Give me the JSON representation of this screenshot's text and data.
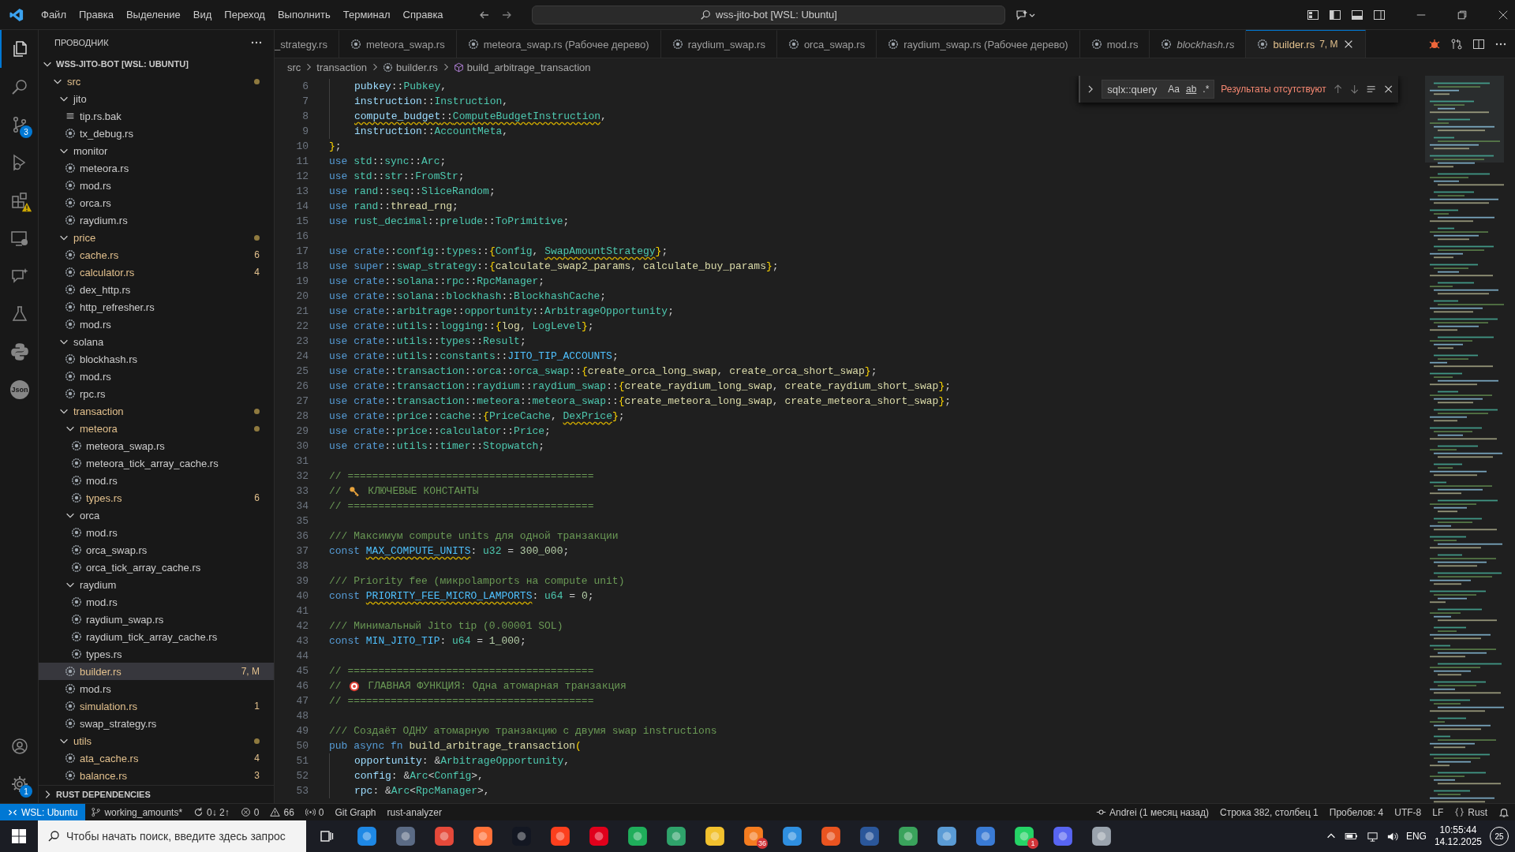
{
  "title_bar": {
    "menu": [
      "Файл",
      "Правка",
      "Выделение",
      "Вид",
      "Переход",
      "Выполнить",
      "Терминал",
      "Справка"
    ],
    "search": "wss-jito-bot [WSL: Ubuntu]"
  },
  "activity_bar": {
    "top": [
      {
        "kind": "files",
        "selected": true
      },
      {
        "kind": "search",
        "selected": false
      },
      {
        "kind": "source-control",
        "selected": false,
        "badge": "3"
      },
      {
        "kind": "run",
        "selected": false
      },
      {
        "kind": "extensions",
        "selected": false,
        "warning": true
      },
      {
        "kind": "remote",
        "selected": false
      },
      {
        "kind": "chat",
        "selected": false
      },
      {
        "kind": "testing",
        "selected": false
      },
      {
        "kind": "python",
        "selected": false
      },
      {
        "kind": "json",
        "selected": false,
        "label": "Json"
      }
    ],
    "bottom": [
      {
        "kind": "account",
        "selected": false
      },
      {
        "kind": "settings",
        "selected": false,
        "badge": "1"
      }
    ]
  },
  "explorer": {
    "title": "ПРОВОДНИК",
    "root": {
      "name": "WSS-JITO-BOT [WSL: UBUNTU]",
      "expanded": true,
      "children": [
        {
          "name": "src",
          "kind": "folder",
          "expanded": true,
          "modified": true,
          "selected": false,
          "children": [
            {
              "name": "jito",
              "kind": "folder",
              "expanded": true,
              "modified": false,
              "selected": false,
              "children": [
                {
                  "name": "tip.rs.bak",
                  "kind": "text-file",
                  "modified": false,
                  "selected": false
                },
                {
                  "name": "tx_debug.rs",
                  "kind": "file",
                  "modified": false,
                  "selected": false
                }
              ]
            },
            {
              "name": "monitor",
              "kind": "folder",
              "expanded": true,
              "modified": false,
              "selected": false,
              "children": [
                {
                  "name": "meteora.rs",
                  "kind": "file",
                  "modified": false,
                  "selected": false
                },
                {
                  "name": "mod.rs",
                  "kind": "file",
                  "modified": false,
                  "selected": false
                },
                {
                  "name": "orca.rs",
                  "kind": "file",
                  "modified": false,
                  "selected": false
                },
                {
                  "name": "raydium.rs",
                  "kind": "file",
                  "modified": false,
                  "selected": false
                }
              ]
            },
            {
              "name": "price",
              "kind": "folder",
              "expanded": true,
              "modified": true,
              "selected": false,
              "children": [
                {
                  "name": "cache.rs",
                  "kind": "file",
                  "modified": true,
                  "selected": false,
                  "badge": "6"
                },
                {
                  "name": "calculator.rs",
                  "kind": "file",
                  "modified": true,
                  "selected": false,
                  "badge": "4"
                },
                {
                  "name": "dex_http.rs",
                  "kind": "file",
                  "modified": false,
                  "selected": false
                },
                {
                  "name": "http_refresher.rs",
                  "kind": "file",
                  "modified": false,
                  "selected": false
                },
                {
                  "name": "mod.rs",
                  "kind": "file",
                  "modified": false,
                  "selected": false
                }
              ]
            },
            {
              "name": "solana",
              "kind": "folder",
              "expanded": true,
              "modified": false,
              "selected": false,
              "children": [
                {
                  "name": "blockhash.rs",
                  "kind": "file",
                  "modified": false,
                  "selected": false
                },
                {
                  "name": "mod.rs",
                  "kind": "file",
                  "modified": false,
                  "selected": false
                },
                {
                  "name": "rpc.rs",
                  "kind": "file",
                  "modified": false,
                  "selected": false
                }
              ]
            },
            {
              "name": "transaction",
              "kind": "folder",
              "expanded": true,
              "modified": true,
              "selected": false,
              "children": [
                {
                  "name": "meteora",
                  "kind": "folder",
                  "expanded": true,
                  "modified": true,
                  "selected": false,
                  "children": [
                    {
                      "name": "meteora_swap.rs",
                      "kind": "file",
                      "modified": false,
                      "selected": false
                    },
                    {
                      "name": "meteora_tick_array_cache.rs",
                      "kind": "file",
                      "modified": false,
                      "selected": false
                    },
                    {
                      "name": "mod.rs",
                      "kind": "file",
                      "modified": false,
                      "selected": false
                    },
                    {
                      "name": "types.rs",
                      "kind": "file",
                      "modified": true,
                      "selected": false,
                      "badge": "6"
                    }
                  ]
                },
                {
                  "name": "orca",
                  "kind": "folder",
                  "expanded": true,
                  "modified": false,
                  "selected": false,
                  "children": [
                    {
                      "name": "mod.rs",
                      "kind": "file",
                      "modified": false,
                      "selected": false
                    },
                    {
                      "name": "orca_swap.rs",
                      "kind": "file",
                      "modified": false,
                      "selected": false
                    },
                    {
                      "name": "orca_tick_array_cache.rs",
                      "kind": "file",
                      "modified": false,
                      "selected": false
                    }
                  ]
                },
                {
                  "name": "raydium",
                  "kind": "folder",
                  "expanded": true,
                  "modified": false,
                  "selected": false,
                  "children": [
                    {
                      "name": "mod.rs",
                      "kind": "file",
                      "modified": false,
                      "selected": false
                    },
                    {
                      "name": "raydium_swap.rs",
                      "kind": "file",
                      "modified": false,
                      "selected": false
                    },
                    {
                      "name": "raydium_tick_array_cache.rs",
                      "kind": "file",
                      "modified": false,
                      "selected": false
                    },
                    {
                      "name": "types.rs",
                      "kind": "file",
                      "modified": false,
                      "selected": false
                    }
                  ]
                },
                {
                  "name": "builder.rs",
                  "kind": "file",
                  "modified": true,
                  "selected": true,
                  "badge": "7, M"
                },
                {
                  "name": "mod.rs",
                  "kind": "file",
                  "modified": false,
                  "selected": false
                },
                {
                  "name": "simulation.rs",
                  "kind": "file",
                  "modified": true,
                  "selected": false,
                  "badge": "1"
                },
                {
                  "name": "swap_strategy.rs",
                  "kind": "file",
                  "modified": false,
                  "selected": false
                }
              ]
            },
            {
              "name": "utils",
              "kind": "folder",
              "expanded": true,
              "modified": true,
              "selected": false,
              "children": [
                {
                  "name": "ata_cache.rs",
                  "kind": "file",
                  "modified": true,
                  "selected": false,
                  "badge": "4"
                },
                {
                  "name": "balance.rs",
                  "kind": "file",
                  "modified": true,
                  "selected": false,
                  "badge": "3"
                }
              ]
            }
          ]
        }
      ]
    },
    "footer": {
      "name": "RUST DEPENDENCIES",
      "expanded": false
    }
  },
  "tabs": [
    {
      "label": "_strategy.rs",
      "kind": "partial",
      "selected": false,
      "preview": false,
      "modified": false
    },
    {
      "label": "meteora_swap.rs",
      "kind": "rust",
      "selected": false,
      "preview": false,
      "modified": false
    },
    {
      "label": "meteora_swap.rs (Рабочее дерево)",
      "kind": "rust",
      "selected": false,
      "preview": false,
      "modified": false
    },
    {
      "label": "raydium_swap.rs",
      "kind": "rust",
      "selected": false,
      "preview": false,
      "modified": false
    },
    {
      "label": "orca_swap.rs",
      "kind": "rust",
      "selected": false,
      "preview": false,
      "modified": false
    },
    {
      "label": "raydium_swap.rs (Рабочее дерево)",
      "kind": "rust",
      "selected": false,
      "preview": false,
      "modified": false
    },
    {
      "label": "mod.rs",
      "kind": "rust",
      "selected": false,
      "preview": false,
      "modified": false
    },
    {
      "label": "blockhash.rs",
      "kind": "rust",
      "selected": false,
      "preview": true,
      "modified": false
    },
    {
      "label": "builder.rs",
      "kind": "rust",
      "selected": true,
      "preview": false,
      "modified": true,
      "badge": "7, M"
    }
  ],
  "breadcrumbs": [
    {
      "label": "src"
    },
    {
      "label": "transaction"
    },
    {
      "label": "builder.rs",
      "kind": "file"
    },
    {
      "label": "build_arbitrage_transaction",
      "kind": "function"
    }
  ],
  "find": {
    "value": "sqlx::query",
    "options": [
      {
        "label": "Aa"
      },
      {
        "label": "ab",
        "kind": "word"
      },
      {
        "label": ".*"
      }
    ],
    "message": "Результаты отсутствуют"
  },
  "code": [
    {
      "number": "6",
      "indented": true,
      "tokens": [
        {
          "text": "pubkey",
          "kind": "var"
        },
        {
          "text": "::",
          "kind": "p"
        },
        {
          "text": "Pubkey",
          "kind": "type"
        },
        {
          "text": ",",
          "kind": "p"
        }
      ]
    },
    {
      "number": "7",
      "indented": true,
      "tokens": [
        {
          "text": "instruction",
          "kind": "var"
        },
        {
          "text": "::",
          "kind": "p"
        },
        {
          "text": "Instruction",
          "kind": "type"
        },
        {
          "text": ",",
          "kind": "p"
        }
      ]
    },
    {
      "number": "8",
      "indented": true,
      "tokens": [
        {
          "text": "compute_budget",
          "kind": "var",
          "warn": true
        },
        {
          "text": "::",
          "kind": "p",
          "warn": true
        },
        {
          "text": "ComputeBudgetInstruction",
          "kind": "type",
          "warn": true
        },
        {
          "text": ",",
          "kind": "p"
        }
      ]
    },
    {
      "number": "9",
      "indented": true,
      "tokens": [
        {
          "text": "instruction",
          "kind": "var"
        },
        {
          "text": "::",
          "kind": "p"
        },
        {
          "text": "AccountMeta",
          "kind": "type"
        },
        {
          "text": ",",
          "kind": "p"
        }
      ]
    },
    {
      "number": "10",
      "indented": false,
      "tokens": [
        {
          "text": "}",
          "kind": "br"
        },
        {
          "text": ";",
          "kind": "p"
        }
      ]
    },
    {
      "number": "11",
      "indented": false,
      "tokens": [
        {
          "text": "use ",
          "kind": "kw"
        },
        {
          "text": "std",
          "kind": "mod"
        },
        {
          "text": "::",
          "kind": "p"
        },
        {
          "text": "sync",
          "kind": "mod"
        },
        {
          "text": "::",
          "kind": "p"
        },
        {
          "text": "Arc",
          "kind": "type"
        },
        {
          "text": ";",
          "kind": "p"
        }
      ]
    },
    {
      "number": "12",
      "indented": false,
      "tokens": [
        {
          "text": "use ",
          "kind": "kw"
        },
        {
          "text": "std",
          "kind": "mod"
        },
        {
          "text": "::",
          "kind": "p"
        },
        {
          "text": "str",
          "kind": "mod"
        },
        {
          "text": "::",
          "kind": "p"
        },
        {
          "text": "FromStr",
          "kind": "type"
        },
        {
          "text": ";",
          "kind": "p"
        }
      ]
    },
    {
      "number": "13",
      "indented": false,
      "tokens": [
        {
          "text": "use ",
          "kind": "kw"
        },
        {
          "text": "rand",
          "kind": "mod"
        },
        {
          "text": "::",
          "kind": "p"
        },
        {
          "text": "seq",
          "kind": "mod"
        },
        {
          "text": "::",
          "kind": "p"
        },
        {
          "text": "SliceRandom",
          "kind": "type"
        },
        {
          "text": ";",
          "kind": "p"
        }
      ]
    },
    {
      "number": "14",
      "indented": false,
      "tokens": [
        {
          "text": "use ",
          "kind": "kw"
        },
        {
          "text": "rand",
          "kind": "mod"
        },
        {
          "text": "::",
          "kind": "p"
        },
        {
          "text": "thread_rng",
          "kind": "fn"
        },
        {
          "text": ";",
          "kind": "p"
        }
      ]
    },
    {
      "number": "15",
      "indented": false,
      "tokens": [
        {
          "text": "use ",
          "kind": "kw"
        },
        {
          "text": "rust_decimal",
          "kind": "mod"
        },
        {
          "text": "::",
          "kind": "p"
        },
        {
          "text": "prelude",
          "kind": "mod"
        },
        {
          "text": "::",
          "kind": "p"
        },
        {
          "text": "ToPrimitive",
          "kind": "type"
        },
        {
          "text": ";",
          "kind": "p"
        }
      ]
    },
    {
      "number": "16"
    },
    {
      "number": "17",
      "indented": false,
      "tokens": [
        {
          "text": "use ",
          "kind": "kw"
        },
        {
          "text": "crate",
          "kind": "kw"
        },
        {
          "text": "::",
          "kind": "p"
        },
        {
          "text": "config",
          "kind": "mod"
        },
        {
          "text": "::",
          "kind": "p"
        },
        {
          "text": "types",
          "kind": "mod"
        },
        {
          "text": "::",
          "kind": "p"
        },
        {
          "text": "{",
          "kind": "br"
        },
        {
          "text": "Config",
          "kind": "type"
        },
        {
          "text": ", ",
          "kind": "p"
        },
        {
          "text": "SwapAmountStrategy",
          "kind": "type",
          "warn": true
        },
        {
          "text": "}",
          "kind": "br"
        },
        {
          "text": ";",
          "kind": "p"
        }
      ]
    },
    {
      "number": "18",
      "indented": false,
      "tokens": [
        {
          "text": "use ",
          "kind": "kw"
        },
        {
          "text": "super",
          "kind": "kw"
        },
        {
          "text": "::",
          "kind": "p"
        },
        {
          "text": "swap_strategy",
          "kind": "mod"
        },
        {
          "text": "::",
          "kind": "p"
        },
        {
          "text": "{",
          "kind": "br"
        },
        {
          "text": "calculate_swap2_params",
          "kind": "fn"
        },
        {
          "text": ", ",
          "kind": "p"
        },
        {
          "text": "calculate_buy_params",
          "kind": "fn"
        },
        {
          "text": "}",
          "kind": "br"
        },
        {
          "text": ";",
          "kind": "p"
        }
      ]
    },
    {
      "number": "19",
      "indented": false,
      "tokens": [
        {
          "text": "use ",
          "kind": "kw"
        },
        {
          "text": "crate",
          "kind": "kw"
        },
        {
          "text": "::",
          "kind": "p"
        },
        {
          "text": "solana",
          "kind": "mod"
        },
        {
          "text": "::",
          "kind": "p"
        },
        {
          "text": "rpc",
          "kind": "mod"
        },
        {
          "text": "::",
          "kind": "p"
        },
        {
          "text": "RpcManager",
          "kind": "type"
        },
        {
          "text": ";",
          "kind": "p"
        }
      ]
    },
    {
      "number": "20",
      "indented": false,
      "tokens": [
        {
          "text": "use ",
          "kind": "kw"
        },
        {
          "text": "crate",
          "kind": "kw"
        },
        {
          "text": "::",
          "kind": "p"
        },
        {
          "text": "solana",
          "kind": "mod"
        },
        {
          "text": "::",
          "kind": "p"
        },
        {
          "text": "blockhash",
          "kind": "mod"
        },
        {
          "text": "::",
          "kind": "p"
        },
        {
          "text": "BlockhashCache",
          "kind": "type"
        },
        {
          "text": ";",
          "kind": "p"
        }
      ]
    },
    {
      "number": "21",
      "indented": false,
      "tokens": [
        {
          "text": "use ",
          "kind": "kw"
        },
        {
          "text": "crate",
          "kind": "kw"
        },
        {
          "text": "::",
          "kind": "p"
        },
        {
          "text": "arbitrage",
          "kind": "mod"
        },
        {
          "text": "::",
          "kind": "p"
        },
        {
          "text": "opportunity",
          "kind": "mod"
        },
        {
          "text": "::",
          "kind": "p"
        },
        {
          "text": "ArbitrageOpportunity",
          "kind": "type"
        },
        {
          "text": ";",
          "kind": "p"
        }
      ]
    },
    {
      "number": "22",
      "indented": false,
      "tokens": [
        {
          "text": "use ",
          "kind": "kw"
        },
        {
          "text": "crate",
          "kind": "kw"
        },
        {
          "text": "::",
          "kind": "p"
        },
        {
          "text": "utils",
          "kind": "mod"
        },
        {
          "text": "::",
          "kind": "p"
        },
        {
          "text": "logging",
          "kind": "mod"
        },
        {
          "text": "::",
          "kind": "p"
        },
        {
          "text": "{",
          "kind": "br"
        },
        {
          "text": "log",
          "kind": "fn"
        },
        {
          "text": ", ",
          "kind": "p"
        },
        {
          "text": "LogLevel",
          "kind": "type"
        },
        {
          "text": "}",
          "kind": "br"
        },
        {
          "text": ";",
          "kind": "p"
        }
      ]
    },
    {
      "number": "23",
      "indented": false,
      "tokens": [
        {
          "text": "use ",
          "kind": "kw"
        },
        {
          "text": "crate",
          "kind": "kw"
        },
        {
          "text": "::",
          "kind": "p"
        },
        {
          "text": "utils",
          "kind": "mod"
        },
        {
          "text": "::",
          "kind": "p"
        },
        {
          "text": "types",
          "kind": "mod"
        },
        {
          "text": "::",
          "kind": "p"
        },
        {
          "text": "Result",
          "kind": "type"
        },
        {
          "text": ";",
          "kind": "p"
        }
      ]
    },
    {
      "number": "24",
      "indented": false,
      "tokens": [
        {
          "text": "use ",
          "kind": "kw"
        },
        {
          "text": "crate",
          "kind": "kw"
        },
        {
          "text": "::",
          "kind": "p"
        },
        {
          "text": "utils",
          "kind": "mod"
        },
        {
          "text": "::",
          "kind": "p"
        },
        {
          "text": "constants",
          "kind": "mod"
        },
        {
          "text": "::",
          "kind": "p"
        },
        {
          "text": "JITO_TIP_ACCOUNTS",
          "kind": "const"
        },
        {
          "text": ";",
          "kind": "p"
        }
      ]
    },
    {
      "number": "25",
      "indented": false,
      "tokens": [
        {
          "text": "use ",
          "kind": "kw"
        },
        {
          "text": "crate",
          "kind": "kw"
        },
        {
          "text": "::",
          "kind": "p"
        },
        {
          "text": "transaction",
          "kind": "mod"
        },
        {
          "text": "::",
          "kind": "p"
        },
        {
          "text": "orca",
          "kind": "mod"
        },
        {
          "text": "::",
          "kind": "p"
        },
        {
          "text": "orca_swap",
          "kind": "mod"
        },
        {
          "text": "::",
          "kind": "p"
        },
        {
          "text": "{",
          "kind": "br"
        },
        {
          "text": "create_orca_long_swap",
          "kind": "fn"
        },
        {
          "text": ", ",
          "kind": "p"
        },
        {
          "text": "create_orca_short_swap",
          "kind": "fn"
        },
        {
          "text": "}",
          "kind": "br"
        },
        {
          "text": ";",
          "kind": "p"
        }
      ]
    },
    {
      "number": "26",
      "indented": false,
      "tokens": [
        {
          "text": "use ",
          "kind": "kw"
        },
        {
          "text": "crate",
          "kind": "kw"
        },
        {
          "text": "::",
          "kind": "p"
        },
        {
          "text": "transaction",
          "kind": "mod"
        },
        {
          "text": "::",
          "kind": "p"
        },
        {
          "text": "raydium",
          "kind": "mod"
        },
        {
          "text": "::",
          "kind": "p"
        },
        {
          "text": "raydium_swap",
          "kind": "mod"
        },
        {
          "text": "::",
          "kind": "p"
        },
        {
          "text": "{",
          "kind": "br"
        },
        {
          "text": "create_raydium_long_swap",
          "kind": "fn"
        },
        {
          "text": ", ",
          "kind": "p"
        },
        {
          "text": "create_raydium_short_swap",
          "kind": "fn"
        },
        {
          "text": "}",
          "kind": "br"
        },
        {
          "text": ";",
          "kind": "p"
        }
      ]
    },
    {
      "number": "27",
      "indented": false,
      "tokens": [
        {
          "text": "use ",
          "kind": "kw"
        },
        {
          "text": "crate",
          "kind": "kw"
        },
        {
          "text": "::",
          "kind": "p"
        },
        {
          "text": "transaction",
          "kind": "mod"
        },
        {
          "text": "::",
          "kind": "p"
        },
        {
          "text": "meteora",
          "kind": "mod"
        },
        {
          "text": "::",
          "kind": "p"
        },
        {
          "text": "meteora_swap",
          "kind": "mod"
        },
        {
          "text": "::",
          "kind": "p"
        },
        {
          "text": "{",
          "kind": "br"
        },
        {
          "text": "create_meteora_long_swap",
          "kind": "fn"
        },
        {
          "text": ", ",
          "kind": "p"
        },
        {
          "text": "create_meteora_short_swap",
          "kind": "fn"
        },
        {
          "text": "}",
          "kind": "br"
        },
        {
          "text": ";",
          "kind": "p"
        }
      ]
    },
    {
      "number": "28",
      "indented": false,
      "tokens": [
        {
          "text": "use ",
          "kind": "kw"
        },
        {
          "text": "crate",
          "kind": "kw"
        },
        {
          "text": "::",
          "kind": "p"
        },
        {
          "text": "price",
          "kind": "mod"
        },
        {
          "text": "::",
          "kind": "p"
        },
        {
          "text": "cache",
          "kind": "mod"
        },
        {
          "text": "::",
          "kind": "p"
        },
        {
          "text": "{",
          "kind": "br"
        },
        {
          "text": "PriceCache",
          "kind": "type"
        },
        {
          "text": ", ",
          "kind": "p"
        },
        {
          "text": "DexPrice",
          "kind": "type",
          "warn": true
        },
        {
          "text": "}",
          "kind": "br"
        },
        {
          "text": ";",
          "kind": "p"
        }
      ]
    },
    {
      "number": "29",
      "indented": false,
      "tokens": [
        {
          "text": "use ",
          "kind": "kw"
        },
        {
          "text": "crate",
          "kind": "kw"
        },
        {
          "text": "::",
          "kind": "p"
        },
        {
          "text": "price",
          "kind": "mod"
        },
        {
          "text": "::",
          "kind": "p"
        },
        {
          "text": "calculator",
          "kind": "mod"
        },
        {
          "text": "::",
          "kind": "p"
        },
        {
          "text": "Price",
          "kind": "type"
        },
        {
          "text": ";",
          "kind": "p"
        }
      ]
    },
    {
      "number": "30",
      "indented": false,
      "tokens": [
        {
          "text": "use ",
          "kind": "kw"
        },
        {
          "text": "crate",
          "kind": "kw"
        },
        {
          "text": "::",
          "kind": "p"
        },
        {
          "text": "utils",
          "kind": "mod"
        },
        {
          "text": "::",
          "kind": "p"
        },
        {
          "text": "timer",
          "kind": "mod"
        },
        {
          "text": "::",
          "kind": "p"
        },
        {
          "text": "Stopwatch",
          "kind": "type"
        },
        {
          "text": ";",
          "kind": "p"
        }
      ]
    },
    {
      "number": "31"
    },
    {
      "number": "32",
      "indented": false,
      "tokens": [
        {
          "text": "// ========================================",
          "kind": "com"
        }
      ]
    },
    {
      "number": "33",
      "indented": false,
      "tokens": [
        {
          "text": "// ",
          "kind": "com"
        },
        {
          "kind": "key"
        },
        {
          "text": " КЛЮЧЕВЫЕ КОНСТАНТЫ",
          "kind": "com"
        }
      ]
    },
    {
      "number": "34",
      "indented": false,
      "tokens": [
        {
          "text": "// ========================================",
          "kind": "com"
        }
      ]
    },
    {
      "number": "35"
    },
    {
      "number": "36",
      "indented": false,
      "tokens": [
        {
          "text": "/// Максимум compute units для одной транзакции",
          "kind": "com"
        }
      ]
    },
    {
      "number": "37",
      "indented": false,
      "tokens": [
        {
          "text": "const ",
          "kind": "kw"
        },
        {
          "text": "MAX_COMPUTE_UNITS",
          "kind": "const",
          "warn": true
        },
        {
          "text": ": ",
          "kind": "p"
        },
        {
          "text": "u32",
          "kind": "type"
        },
        {
          "text": " = ",
          "kind": "p"
        },
        {
          "text": "300_000",
          "kind": "num"
        },
        {
          "text": ";",
          "kind": "p"
        }
      ]
    },
    {
      "number": "38"
    },
    {
      "number": "39",
      "indented": false,
      "tokens": [
        {
          "text": "/// Priority fee (микроlamports на compute unit)",
          "kind": "com"
        }
      ]
    },
    {
      "number": "40",
      "indented": false,
      "tokens": [
        {
          "text": "const ",
          "kind": "kw"
        },
        {
          "text": "PRIORITY_FEE_MICRO_LAMPORTS",
          "kind": "const",
          "warn": true
        },
        {
          "text": ": ",
          "kind": "p"
        },
        {
          "text": "u64",
          "kind": "type"
        },
        {
          "text": " = ",
          "kind": "p"
        },
        {
          "text": "0",
          "kind": "num"
        },
        {
          "text": ";",
          "kind": "p"
        }
      ]
    },
    {
      "number": "41"
    },
    {
      "number": "42",
      "indented": false,
      "tokens": [
        {
          "text": "/// Минимальный Jito tip (0.00001 SOL)",
          "kind": "com"
        }
      ]
    },
    {
      "number": "43",
      "indented": false,
      "tokens": [
        {
          "text": "const ",
          "kind": "kw"
        },
        {
          "text": "MIN_JITO_TIP",
          "kind": "const"
        },
        {
          "text": ": ",
          "kind": "p"
        },
        {
          "text": "u64",
          "kind": "type"
        },
        {
          "text": " = ",
          "kind": "p"
        },
        {
          "text": "1_000",
          "kind": "num"
        },
        {
          "text": ";",
          "kind": "p"
        }
      ]
    },
    {
      "number": "44"
    },
    {
      "number": "45",
      "indented": false,
      "tokens": [
        {
          "text": "// ========================================",
          "kind": "com"
        }
      ]
    },
    {
      "number": "46",
      "indented": false,
      "tokens": [
        {
          "text": "// ",
          "kind": "com"
        },
        {
          "kind": "target"
        },
        {
          "text": " ГЛАВНАЯ ФУНКЦИЯ: Одна атомарная транзакция",
          "kind": "com"
        }
      ]
    },
    {
      "number": "47",
      "indented": false,
      "tokens": [
        {
          "text": "// ========================================",
          "kind": "com"
        }
      ]
    },
    {
      "number": "48"
    },
    {
      "number": "49",
      "indented": false,
      "tokens": [
        {
          "text": "/// Создаёт ОДНУ атомарную транзакцию с двумя swap instructions",
          "kind": "com"
        }
      ]
    },
    {
      "number": "50",
      "indented": false,
      "tokens": [
        {
          "text": "pub async fn ",
          "kind": "kw"
        },
        {
          "text": "build_arbitrage_transaction",
          "kind": "fn"
        },
        {
          "text": "(",
          "kind": "br"
        }
      ]
    },
    {
      "number": "51",
      "indented": true,
      "tokens": [
        {
          "text": "opportunity",
          "kind": "var"
        },
        {
          "text": ": &",
          "kind": "p"
        },
        {
          "text": "ArbitrageOpportunity",
          "kind": "type"
        },
        {
          "text": ",",
          "kind": "p"
        }
      ]
    },
    {
      "number": "52",
      "indented": true,
      "tokens": [
        {
          "text": "config",
          "kind": "var"
        },
        {
          "text": ": &",
          "kind": "p"
        },
        {
          "text": "Arc",
          "kind": "type"
        },
        {
          "text": "<",
          "kind": "p"
        },
        {
          "text": "Config",
          "kind": "type"
        },
        {
          "text": ">,",
          "kind": "p"
        }
      ]
    },
    {
      "number": "53",
      "indented": true,
      "tokens": [
        {
          "text": "rpc",
          "kind": "var"
        },
        {
          "text": ": &",
          "kind": "p"
        },
        {
          "text": "Arc",
          "kind": "type"
        },
        {
          "text": "<",
          "kind": "p"
        },
        {
          "text": "RpcManager",
          "kind": "type"
        },
        {
          "text": ">,",
          "kind": "p"
        }
      ]
    }
  ],
  "status_bar": {
    "left": [
      {
        "kind": "remote",
        "text": "WSL: Ubuntu"
      },
      {
        "kind": "branch",
        "text": "working_amounts*"
      },
      {
        "kind": "sync",
        "text": "0↓ 2↑"
      },
      {
        "kind": "errors",
        "text": "0"
      },
      {
        "kind": "warnings",
        "text": "66"
      },
      {
        "kind": "ports",
        "text": "0"
      },
      {
        "text": "Git Graph"
      },
      {
        "text": "rust-analyzer"
      }
    ],
    "right": [
      {
        "kind": "blame",
        "text": "Andrei (1 месяц назад)"
      },
      {
        "text": "Строка 382, столбец 1"
      },
      {
        "text": "Пробелов: 4"
      },
      {
        "text": "UTF-8"
      },
      {
        "text": "LF"
      },
      {
        "kind": "language",
        "text": "Rust"
      },
      {
        "kind": "bell"
      }
    ]
  },
  "taskbar": {
    "search_placeholder": "Чтобы начать поиск, введите здесь запрос",
    "apps": [
      {
        "color": "#1e88e5"
      },
      {
        "color": "#5b6b85"
      },
      {
        "color": "#e5493a"
      },
      {
        "color": "#ff7139"
      },
      {
        "color": "#131722"
      },
      {
        "color": "#fc3f1d"
      },
      {
        "color": "#e0001b"
      },
      {
        "color": "#1fae5b"
      },
      {
        "color": "#2fa36b"
      },
      {
        "color": "#f2c12e"
      },
      {
        "color": "#f47c20",
        "badge": "36"
      },
      {
        "color": "#2f8fe0"
      },
      {
        "color": "#e95420"
      },
      {
        "color": "#2b579a"
      },
      {
        "color": "#3aa35c"
      },
      {
        "color": "#5a9bd5"
      },
      {
        "color": "#3a7bd5"
      },
      {
        "color": "#25d366",
        "badge": "1"
      },
      {
        "color": "#5865f2"
      },
      {
        "color": "#9aa3ad"
      }
    ],
    "tray": {
      "language": "ENG",
      "time": "10:55:44",
      "date": "14.12.2025",
      "notifications": "25"
    }
  }
}
